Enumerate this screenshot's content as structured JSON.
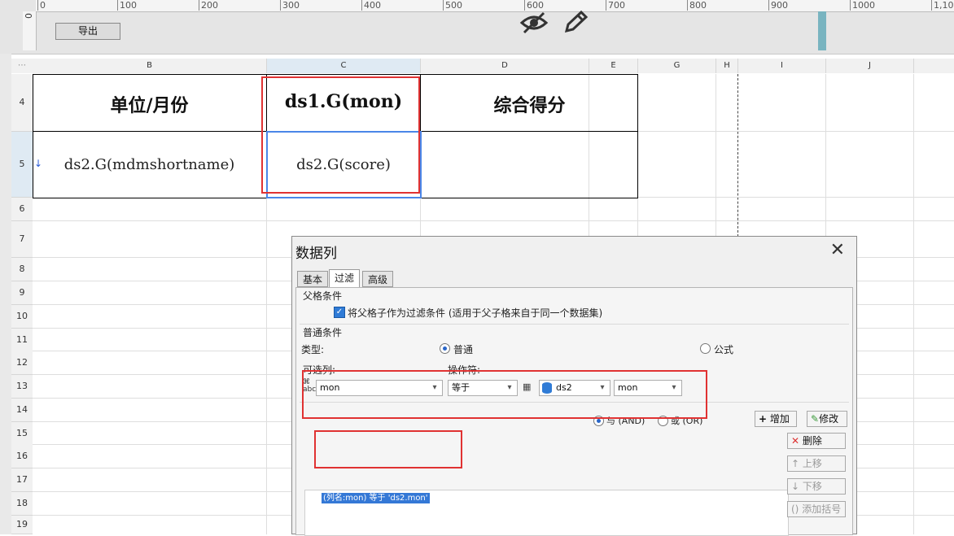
{
  "ruler": {
    "vertical_label": "0",
    "ticks": [
      "0",
      "100",
      "200",
      "300",
      "400",
      "500",
      "600",
      "700",
      "800",
      "900",
      "1000",
      "1,10"
    ]
  },
  "toolbar": {
    "export_label": "导出"
  },
  "icons": {
    "hide": "eye-off-icon",
    "edit": "pencil-icon"
  },
  "sheet": {
    "columns": [
      "B",
      "C",
      "D",
      "E",
      "G",
      "H",
      "I",
      "J"
    ],
    "rows": [
      "4",
      "5",
      "6",
      "7",
      "8",
      "9",
      "10",
      "11",
      "12",
      "13",
      "14",
      "15",
      "16",
      "17",
      "18",
      "19"
    ],
    "cells": {
      "B4": "单位/月份",
      "C4": "ds1.G(mon)",
      "D4": "综合得分",
      "B5": "ds2.G(mdmshortname)",
      "C5": "ds2.G(score)"
    }
  },
  "dialog": {
    "title": "数据列",
    "tabs": [
      "基本",
      "过滤",
      "高级"
    ],
    "active_tab": "过滤",
    "parent_condition": {
      "title": "父格条件",
      "checkbox_label": "将父格子作为过滤条件 (适用于父子格来自于同一个数据集)",
      "checked": true
    },
    "normal_condition": {
      "title": "普通条件",
      "type_label": "类型:",
      "type_normal": "普通",
      "type_formula": "公式",
      "selected_type": "普通",
      "optional_column_label": "可选列:",
      "operator_label": "操作符:",
      "column_value": "mon",
      "operator_value": "等于",
      "dataset_value": "ds2",
      "value_column": "mon",
      "and_label": "与 (AND)",
      "or_label": "或 (OR)",
      "logic_selected": "AND",
      "add_label": "增加",
      "modify_label": "修改",
      "delete_label": "删除",
      "move_up_label": "上移",
      "move_down_label": "下移",
      "add_bracket_label": "添加括号",
      "conditions": [
        "(列名:mon) 等于 'ds2.mon'"
      ]
    }
  },
  "colors": {
    "highlight_red": "#e03232",
    "selection_blue": "#4a86e8",
    "teal": "#79b4c0"
  }
}
